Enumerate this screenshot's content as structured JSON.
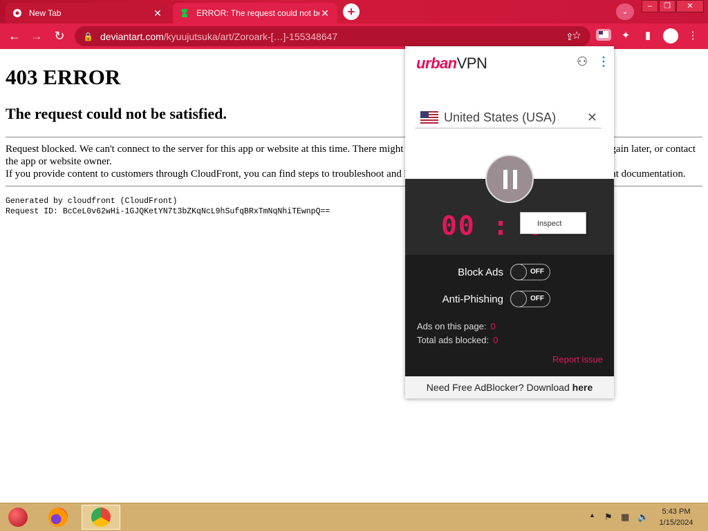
{
  "browser": {
    "tabs": [
      {
        "title": "New Tab",
        "close": "✕"
      },
      {
        "title": "ERROR: The request could not be",
        "close": "✕"
      }
    ],
    "new_tab": "+",
    "tab_search": "⌄",
    "window_controls": {
      "minimize": "–",
      "maximize": "❐",
      "close": "✕"
    },
    "nav": {
      "back": "←",
      "forward": "→",
      "reload": "↻"
    },
    "url_domain": "deviantart.com",
    "url_path": "/kyuujutsuka/art/Zoroark-[…]-155348647",
    "lock_icon": "🔒",
    "icons": {
      "share": "⇪",
      "star": "☆",
      "extension": "✦",
      "sidepanel": "▮",
      "menu": "⋮"
    }
  },
  "page": {
    "heading": "403 ERROR",
    "subheading": "The request could not be satisfied.",
    "para1": "Request blocked. We can't connect to the server for this app or website at this time. There might be too much traffic or a configuration error. Try again later, or contact the app or website owner.",
    "para2": "If you provide content to customers through CloudFront, you can find steps to troubleshoot and help prevent this error by reviewing the CloudFront documentation.",
    "generated_by": "Generated by cloudfront (CloudFront)",
    "request_id": "Request ID: BcCeL0v62wHi-1GJQKetYN7t3bZKqNcL9hSufqBRxTmNqNhiTEwnpQ=="
  },
  "vpn": {
    "logo_brand": "urban",
    "logo_vpn": "VPN",
    "icons": {
      "account": "⚇",
      "menu": "⋮"
    },
    "country": "United States (USA)",
    "clear": "✕",
    "timer": "00 : 0",
    "context_menu": "Inspect",
    "block_ads_label": "Block Ads",
    "block_ads_state": "OFF",
    "anti_phishing_label": "Anti-Phishing",
    "anti_phishing_state": "OFF",
    "ads_on_page_label": "Ads on this page:",
    "ads_on_page": "0",
    "total_blocked_label": "Total ads blocked:",
    "total_blocked": "0",
    "report": "Report issue",
    "footer_text": "Need Free AdBlocker? Download ",
    "footer_link": "here",
    "accent": "#e0185c"
  },
  "taskbar": {
    "tray": {
      "up": "▲",
      "flag": "⚑",
      "network": "▦",
      "volume": "🔈"
    },
    "time": "5:43 PM",
    "date": "1/15/2024"
  }
}
